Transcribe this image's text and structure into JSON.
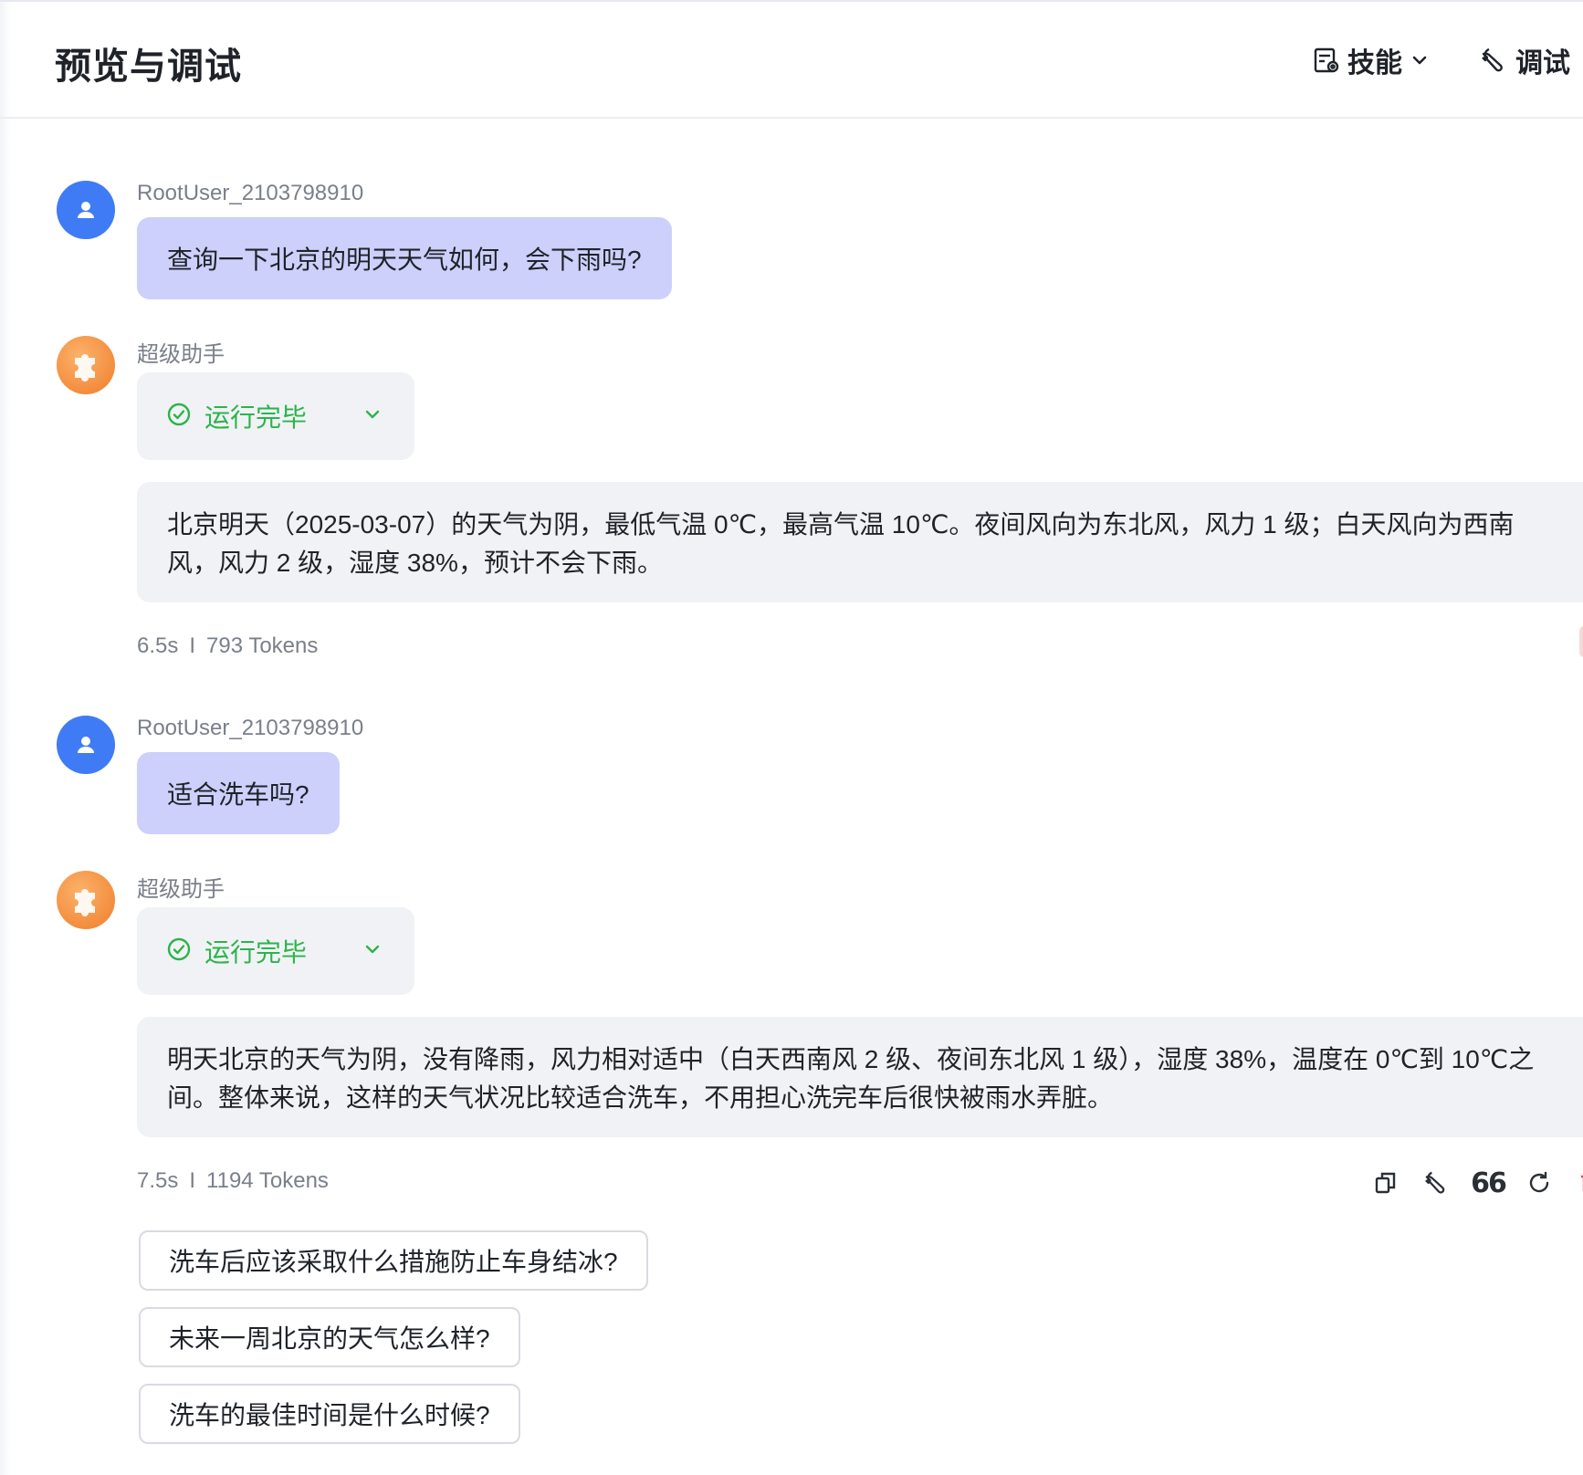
{
  "header": {
    "title": "预览与调试",
    "skills_label": "技能",
    "debug_label": "调试"
  },
  "messages": [
    {
      "role": "user",
      "sender": "RootUser_2103798910",
      "text": "查询一下北京的明天天气如何，会下雨吗?"
    },
    {
      "role": "assistant",
      "sender": "超级助手",
      "status": "运行完毕",
      "answer_lines": [
        "北京明天（2025-03-07）的天气为阴，最低气温 0℃，最高气温 10℃。夜间风向为东北风，风力 1 级；白天风向为西南",
        "风，风力 2 级，湿度 38%，预计不会下雨。"
      ],
      "time": "6.5s",
      "sep": "I",
      "tokens": "793 Tokens"
    },
    {
      "role": "user",
      "sender": "RootUser_2103798910",
      "text": "适合洗车吗?"
    },
    {
      "role": "assistant",
      "sender": "超级助手",
      "status": "运行完毕",
      "answer_lines": [
        "明天北京的天气为阴，没有降雨，风力相对适中（白天西南风 2 级、夜间东北风 1 级），湿度 38%，温度在 0℃到 10℃之",
        "间。整体来说，这样的天气状况比较适合洗车，不用担心洗完车后很快被雨水弄脏。"
      ],
      "time": "7.5s",
      "sep": "I",
      "tokens": "1194 Tokens"
    }
  ],
  "actions": {
    "quote_label": "66"
  },
  "suggestions": [
    "洗车后应该采取什么措施防止车身结冰?",
    "未来一周北京的天气怎么样?",
    "洗车的最佳时间是什么时候?"
  ],
  "colors": {
    "user_avatar": "#3f7bf5",
    "user_bubble": "#cdd0fb",
    "status_green": "#2bb44a",
    "bubble_grey": "#f1f2f5",
    "delete_red": "#e5484d"
  }
}
